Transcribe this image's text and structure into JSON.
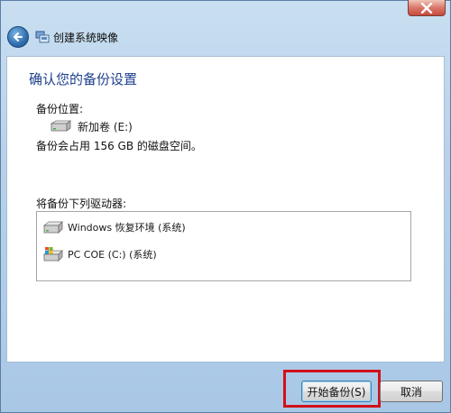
{
  "window": {
    "title": "创建系统映像",
    "close_label": "×"
  },
  "main": {
    "heading": "确认您的备份设置",
    "backup_location_label": "备份位置:",
    "backup_drive_name": "新加卷 (E:)",
    "space_note": "备份会占用 156 GB 的磁盘空间。",
    "drives_label": "将备份下列驱动器:",
    "drives": [
      {
        "icon": "drive-icon",
        "label": "Windows 恢复环境 (系统)"
      },
      {
        "icon": "windows-drive-icon",
        "label": "PC COE (C:) (系统)"
      }
    ]
  },
  "buttons": {
    "start_backup": "开始备份(S)",
    "cancel": "取消"
  },
  "colors": {
    "heading": "#1e3f8c",
    "highlight": "#d2101a",
    "frame": "#b7d1ea"
  }
}
